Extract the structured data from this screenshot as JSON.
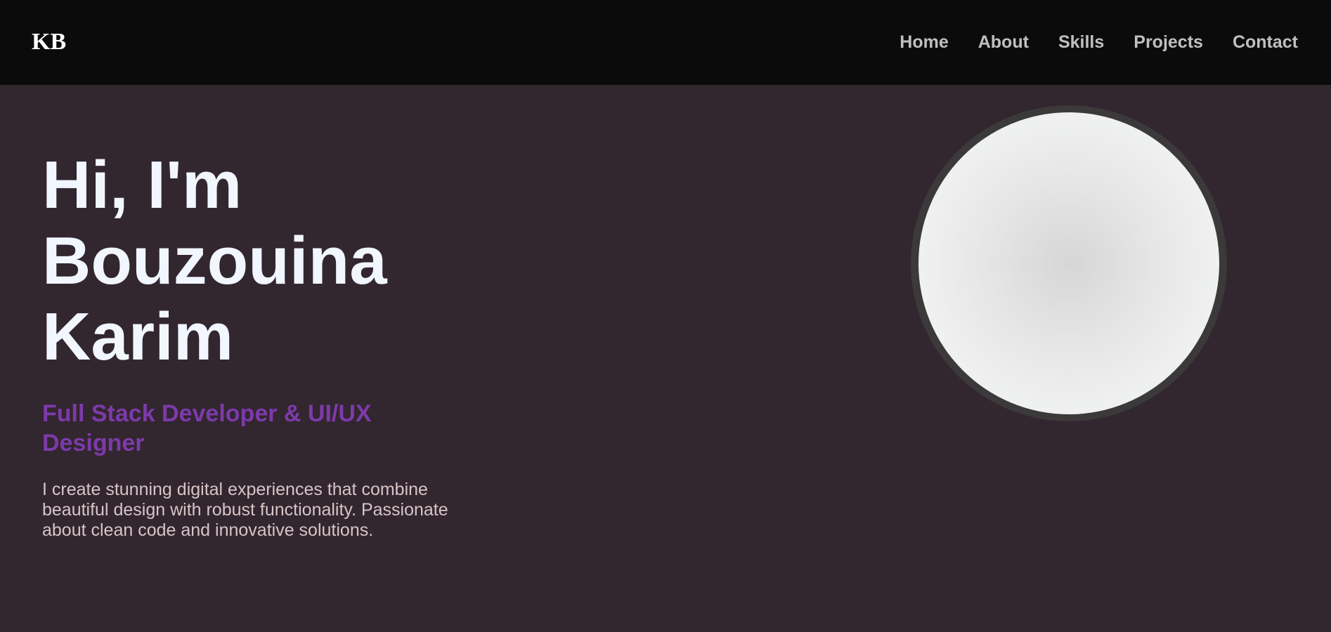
{
  "brand": {
    "logo": "KB"
  },
  "nav": {
    "items": [
      {
        "label": "Home"
      },
      {
        "label": "About"
      },
      {
        "label": "Skills"
      },
      {
        "label": "Projects"
      },
      {
        "label": "Contact"
      }
    ]
  },
  "hero": {
    "title_lines": [
      "Hi, I'm",
      "Bouzouina",
      "Karim"
    ],
    "subtitle": "Full Stack Developer & UI/UX Designer",
    "description": "I create stunning digital experiences that combine beautiful design with robust functionality. Passionate about clean code and innovative solutions."
  },
  "colors": {
    "nav_background": "#0b0b0b",
    "page_background": "#32262f",
    "title": "#f1f6ff",
    "accent": "#7d3aaa",
    "body_text": "#d7c5c6",
    "nav_text": "#c2bfc2"
  }
}
